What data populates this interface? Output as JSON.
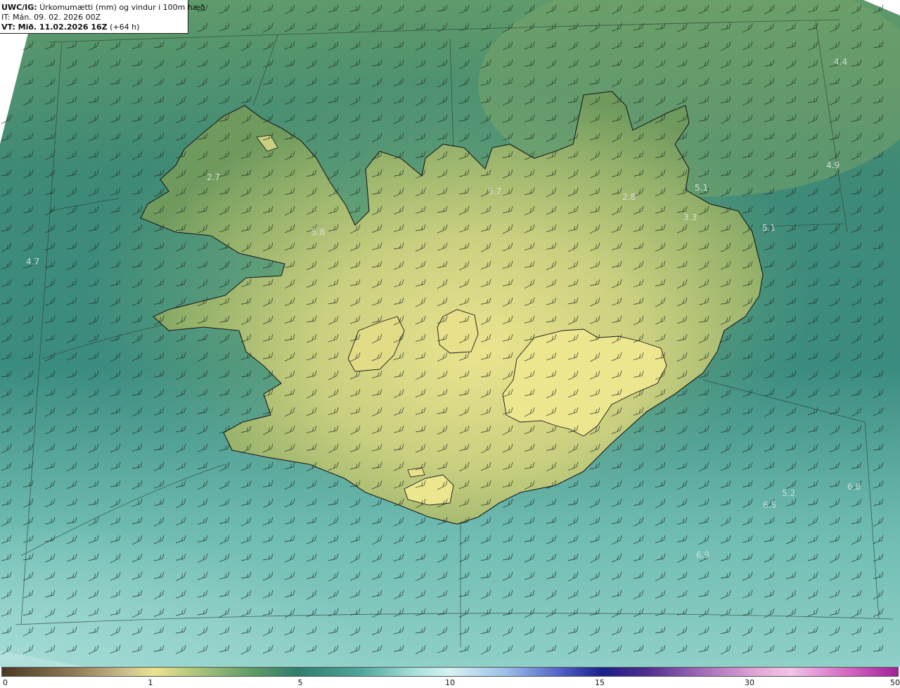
{
  "header": {
    "title_bold": "UWC/IG:",
    "title_rest": "Úrkomumætti (mm) og vindur i 100m hæð",
    "init_time": "IT: Mán. 09. 02. 2026 00Z",
    "valid_bold": "VT: Mið. 11.02.2026 16Z",
    "valid_rest": "(+64 h)"
  },
  "colors": {
    "ocean_light": "#9ed8d2",
    "ocean_mid": "#3f8d82",
    "ocean_dark": "#2e6f62",
    "land_green": "#7fa25f",
    "land_yellow": "#e9e38f",
    "coastline": "#1a1a1a",
    "barb": "#1f2b22"
  },
  "map_labels": [
    {
      "text": "4.4",
      "id": "label-4-4"
    },
    {
      "text": "4.9",
      "id": "label-4-9"
    },
    {
      "text": "5.1",
      "id": "label-5-1-a"
    },
    {
      "text": "5.1",
      "id": "label-5-1-b"
    },
    {
      "text": "2.8",
      "id": "label-2-8"
    },
    {
      "text": "3.3",
      "id": "label-3-3"
    },
    {
      "text": "5.7",
      "id": "label-5-7"
    },
    {
      "text": "5.8",
      "id": "label-5-8"
    },
    {
      "text": "2.7",
      "id": "label-2-7"
    },
    {
      "text": "4.7",
      "id": "label-4-7"
    },
    {
      "text": "5.2",
      "id": "label-5-2"
    },
    {
      "text": "6.8",
      "id": "label-6-8"
    },
    {
      "text": "6.5",
      "id": "label-6-5"
    },
    {
      "text": "6.9",
      "id": "label-6-9"
    }
  ],
  "colorbar": {
    "ticks": [
      "0",
      "1",
      "5",
      "10",
      "15",
      "30",
      "50"
    ]
  }
}
